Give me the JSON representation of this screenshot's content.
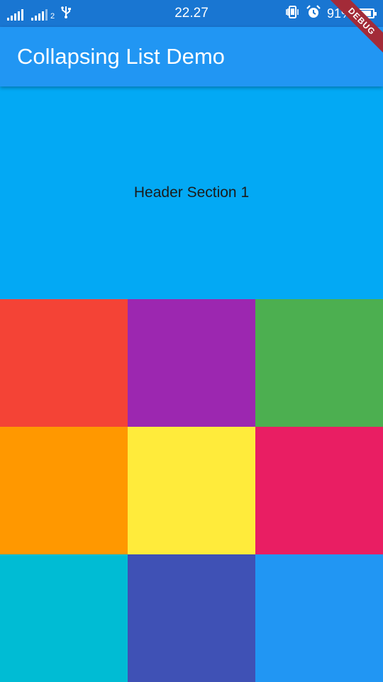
{
  "status_bar": {
    "sim1_label": "",
    "sim2_label": "2",
    "time": "22.27",
    "battery_percent": "91%",
    "battery_level": 0.91,
    "icons": [
      "signal-icon",
      "signal-icon",
      "usb-icon",
      "vibrate-icon",
      "alarm-icon",
      "battery-icon"
    ]
  },
  "app_bar": {
    "title": "Collapsing List Demo"
  },
  "header": {
    "label": "Header Section 1",
    "color": "#03A9F4"
  },
  "grid": {
    "tiles": [
      {
        "name": "red",
        "color": "#F44336"
      },
      {
        "name": "purple",
        "color": "#9C27B0"
      },
      {
        "name": "green",
        "color": "#4CAF50"
      },
      {
        "name": "orange",
        "color": "#FF9800"
      },
      {
        "name": "yellow",
        "color": "#FFEB3B"
      },
      {
        "name": "pink",
        "color": "#E91E63"
      },
      {
        "name": "cyan",
        "color": "#00BCD4"
      },
      {
        "name": "indigo",
        "color": "#3F51B5"
      },
      {
        "name": "blue",
        "color": "#2196F3"
      }
    ]
  },
  "debug_banner": {
    "label": "DEBUG"
  },
  "colors": {
    "status_bar": "#1976D2",
    "app_bar": "#2196F3",
    "debug_banner": "#A32B38"
  }
}
